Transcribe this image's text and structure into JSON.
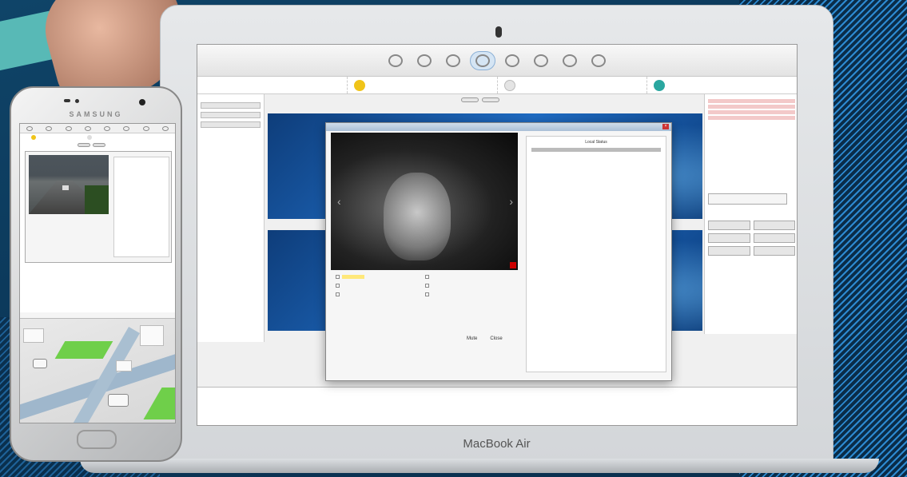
{
  "laptop": {
    "brand": "MacBook Air",
    "dialog": {
      "local_panel_title": "Local Status",
      "actions": [
        "Mute",
        "Close"
      ]
    }
  },
  "phone": {
    "brand": "SAMSUNG"
  },
  "colors": {
    "alarm_red": "#dd0000",
    "active_tab": "#d5e5f4",
    "background_blue": "#0b3556",
    "map_green": "#6fcf4a"
  },
  "icons": [
    "camera-icon",
    "call-status-icon",
    "record-icon",
    "prev-arrow-icon",
    "next-arrow-icon"
  ]
}
